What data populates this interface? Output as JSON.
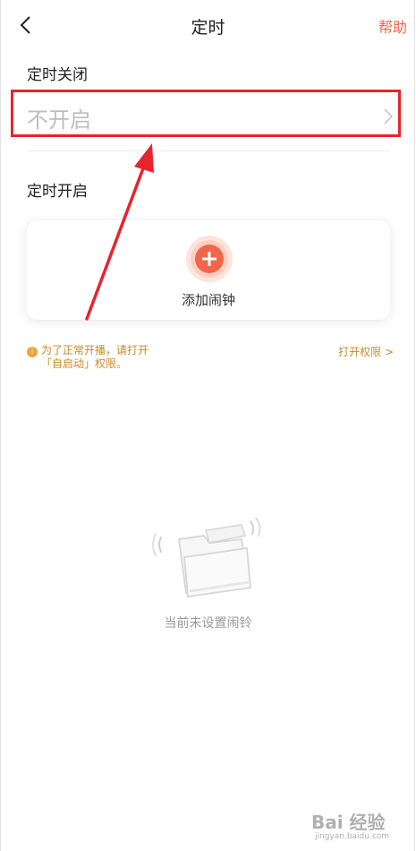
{
  "header": {
    "title": "定时",
    "help_label": "帮助"
  },
  "timer_off": {
    "label": "定时关闭",
    "value": "不开启"
  },
  "timer_on": {
    "label": "定时开启",
    "add_label": "添加闹钟"
  },
  "hint": {
    "text": "为了正常开播，请打开\n「自启动」权限。",
    "link": "打开权限 >"
  },
  "empty_state": {
    "text": "当前未设置闹铃"
  },
  "watermark": {
    "text": "Bai 经验",
    "sub": "jingyan.baidu.com"
  },
  "colors": {
    "accent": "#f0664a",
    "highlight": "#e8232d",
    "hint": "#c88a2a"
  }
}
